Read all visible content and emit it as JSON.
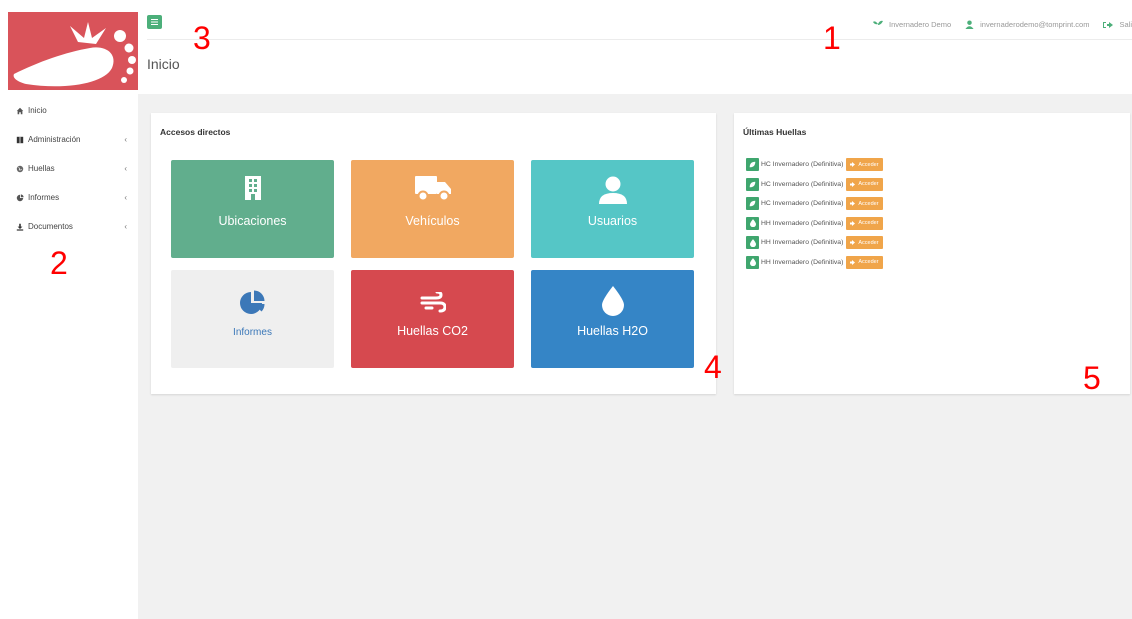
{
  "header": {
    "page_title": "Inicio",
    "workspace": "Invernadero Demo",
    "user_email": "invernaderodemo@tomprint.com",
    "logout_label": "Sali"
  },
  "sidebar": {
    "items": [
      {
        "label": "Inicio",
        "icon": "home-icon",
        "has_children": false
      },
      {
        "label": "Administración",
        "icon": "book-icon",
        "has_children": true
      },
      {
        "label": "Huellas",
        "icon": "globe-icon",
        "has_children": true
      },
      {
        "label": "Informes",
        "icon": "pie-chart-icon",
        "has_children": true
      },
      {
        "label": "Documentos",
        "icon": "download-icon",
        "has_children": true
      }
    ]
  },
  "shortcuts": {
    "title": "Accesos directos",
    "tiles": [
      {
        "label": "Ubicaciones",
        "icon": "building-icon",
        "color": "#61ae8d"
      },
      {
        "label": "Vehículos",
        "icon": "truck-icon",
        "color": "#f1a861"
      },
      {
        "label": "Usuarios",
        "icon": "user-icon",
        "color": "#55c6c6"
      },
      {
        "label": "Informes",
        "icon": "pie-chart-icon",
        "color": "#efefef"
      },
      {
        "label": "Huellas CO2",
        "icon": "wind-icon",
        "color": "#d6494f"
      },
      {
        "label": "Huellas H2O",
        "icon": "water-drop-icon",
        "color": "#3585c6"
      }
    ]
  },
  "recent": {
    "title": "Últimas Huellas",
    "access_label": "Acceder",
    "items": [
      {
        "text": "HC Invernadero  (Definitiva)",
        "icon": "leaf-icon"
      },
      {
        "text": "HC Invernadero  (Definitiva)",
        "icon": "leaf-icon"
      },
      {
        "text": "HC Invernadero  (Definitiva)",
        "icon": "leaf-icon"
      },
      {
        "text": "HH Invernadero  (Definitiva)",
        "icon": "water-drop-icon"
      },
      {
        "text": "HH Invernadero  (Definitiva)",
        "icon": "water-drop-icon"
      },
      {
        "text": "HH Invernadero  (Definitiva)",
        "icon": "water-drop-icon"
      }
    ]
  },
  "annotations": [
    "1",
    "2",
    "3",
    "4",
    "5"
  ],
  "colors": {
    "brand_red": "#d9535a",
    "accent_green": "#4caf7a",
    "access_orange": "#f0a54a",
    "annotation_red": "#ff0000"
  }
}
